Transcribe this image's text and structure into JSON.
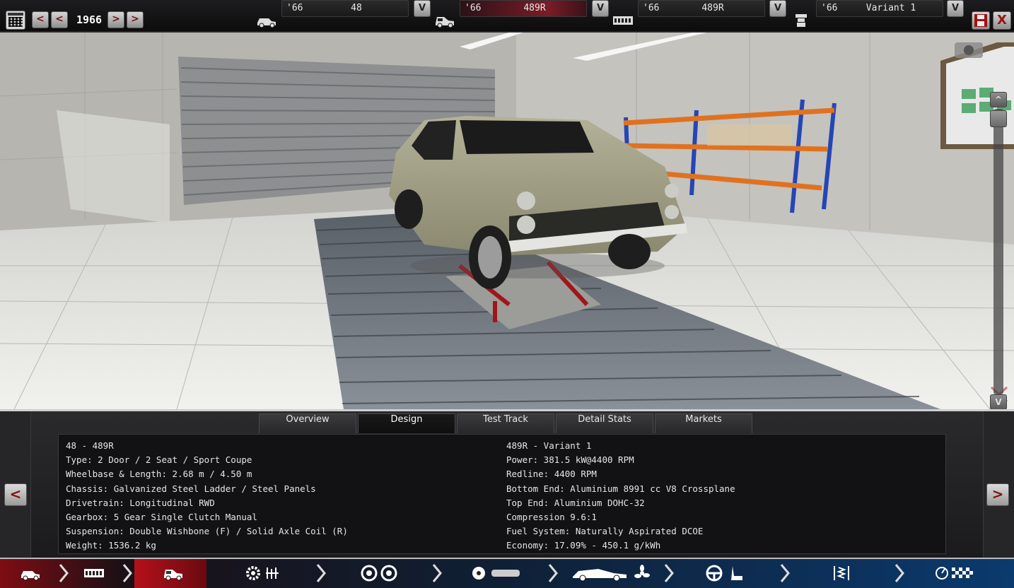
{
  "topbar": {
    "year": "1966",
    "prev_label": "<",
    "next_label": ">",
    "selectors": [
      {
        "icon": "car-model-icon",
        "year": "'66",
        "name": "48",
        "dropdown": "V"
      },
      {
        "icon": "car-trim-icon",
        "year": "'66",
        "name": "489R",
        "dropdown": "V"
      },
      {
        "icon": "engine-family-icon",
        "year": "'66",
        "name": "489R",
        "dropdown": "V"
      },
      {
        "icon": "engine-variant-icon",
        "year": "'66",
        "name": "Variant 1",
        "dropdown": "V"
      }
    ],
    "save_icon": "save-icon",
    "close_label": "X"
  },
  "viewport": {
    "scroll_up": "^",
    "scroll_down": "V"
  },
  "panel": {
    "tabs": [
      "Overview",
      "Design",
      "Test Track",
      "Detail Stats",
      "Markets"
    ],
    "active_tab": "Design",
    "left_specs": [
      "48 - 489R",
      "Type: 2 Door / 2 Seat / Sport Coupe",
      "Wheelbase & Length: 2.68 m / 4.50 m",
      "Chassis: Galvanized Steel Ladder / Steel Panels",
      "Drivetrain: Longitudinal RWD",
      "Gearbox: 5 Gear Single Clutch Manual",
      "Suspension: Double Wishbone (F) / Solid Axle Coil (R)",
      "Weight: 1536.2 kg"
    ],
    "right_specs": [
      "489R - Variant 1",
      "Power: 381.5 kW@4400 RPM",
      "Redline: 4400 RPM",
      "Bottom End: Aluminium 8991 cc V8 Crossplane",
      "Top End: Aluminium DOHC-32",
      "Compression 9.6:1",
      "Fuel System: Naturally Aspirated DCOE",
      "Economy: 17.09% - 450.1 g/kWh"
    ],
    "page_prev": "<",
    "page_next": ">"
  },
  "bottombar": {
    "steps": [
      "car-model-step",
      "engine-step",
      "trim-step",
      "engine-parts-step",
      "wheels-step",
      "body-aero-step",
      "interior-step",
      "suspension-step",
      "testing-step"
    ],
    "active_step": "trim-step"
  }
}
